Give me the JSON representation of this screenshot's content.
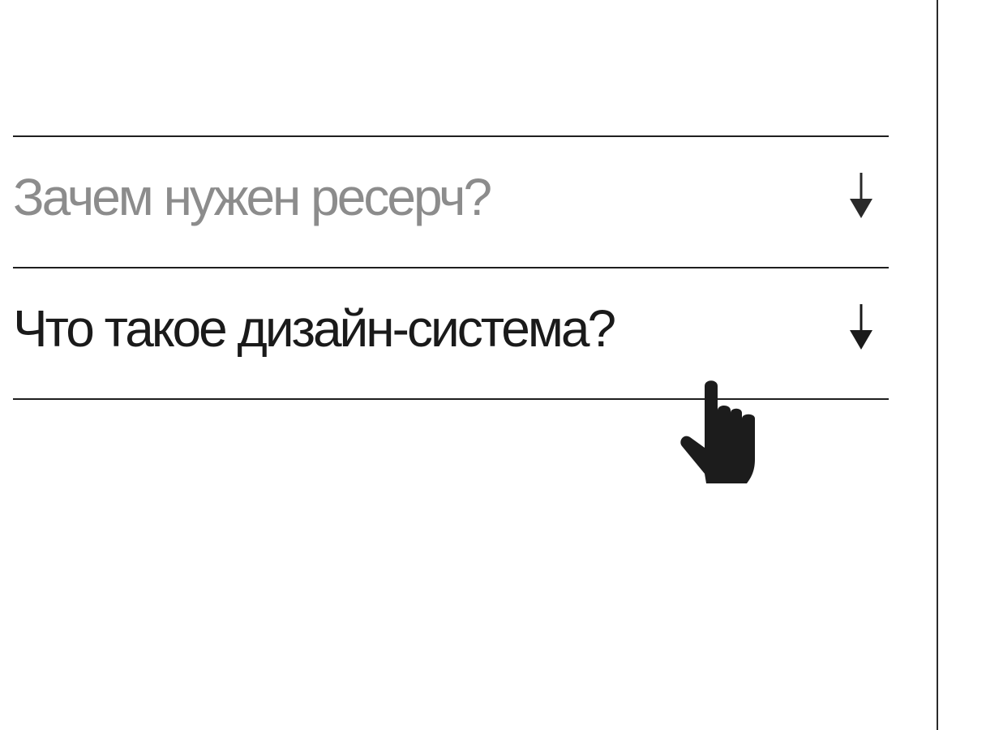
{
  "faq": {
    "items": [
      {
        "question": "Зачем нужен ресерч?",
        "state": "muted"
      },
      {
        "question": "Что такое дизайн-система?",
        "state": "hovered"
      }
    ]
  },
  "icons": {
    "expand": "arrow-down-icon",
    "pointer": "hand-pointer-cursor-icon"
  },
  "colors": {
    "background": "#ffffff",
    "text_active": "#1a1a1a",
    "text_muted": "#8c8c8c",
    "rule": "#1f1f1f"
  }
}
